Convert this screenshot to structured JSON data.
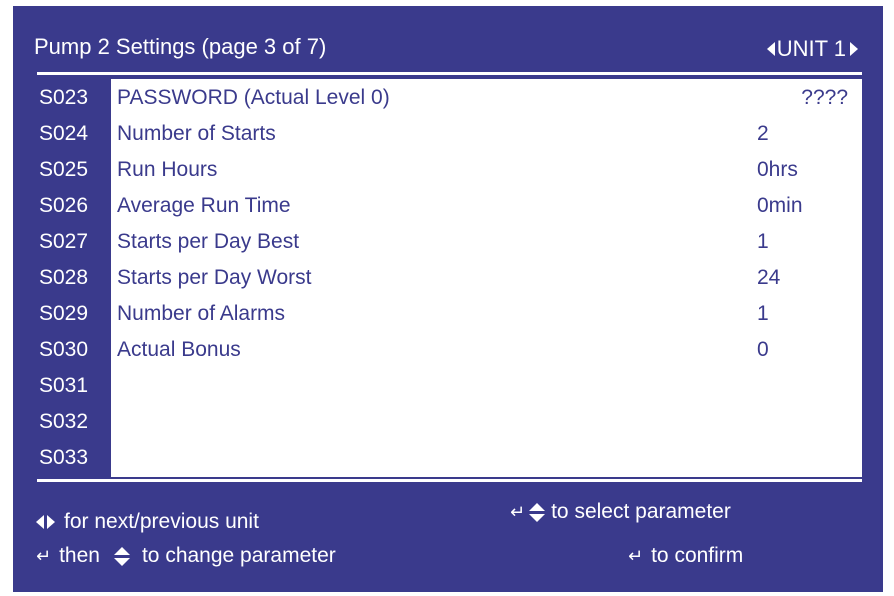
{
  "header": {
    "title": "Pump 2 Settings (page 3 of 7)",
    "unit_label": "UNIT 1"
  },
  "rows": [
    {
      "code": "S023",
      "label": "PASSWORD  (Actual Level  0)",
      "value": "????"
    },
    {
      "code": "S024",
      "label": "Number of Starts",
      "value": "2"
    },
    {
      "code": "S025",
      "label": "Run Hours",
      "value": "0hrs"
    },
    {
      "code": "S026",
      "label": "Average Run Time",
      "value": "0min"
    },
    {
      "code": "S027",
      "label": "Starts per Day Best",
      "value": "1"
    },
    {
      "code": "S028",
      "label": "Starts per Day Worst",
      "value": "24"
    },
    {
      "code": "S029",
      "label": "Number of Alarms",
      "value": "1"
    },
    {
      "code": "S030",
      "label": "Actual Bonus",
      "value": "0"
    },
    {
      "code": "S031",
      "label": "",
      "value": ""
    },
    {
      "code": "S032",
      "label": "",
      "value": ""
    },
    {
      "code": "S033",
      "label": "",
      "value": ""
    }
  ],
  "footer": {
    "next_prev": "for next/previous unit",
    "select_param": "to select parameter",
    "then": "then",
    "change_param": "to change parameter",
    "confirm": "to confirm"
  },
  "icons": {
    "enter": "↵ enter-icon",
    "left_right": "left-right-arrows-icon",
    "up_down": "up-down-arrows-icon"
  },
  "colors": {
    "panel": "#3a3a8c",
    "text_light": "#ffffff",
    "content_bg": "#ffffff"
  }
}
